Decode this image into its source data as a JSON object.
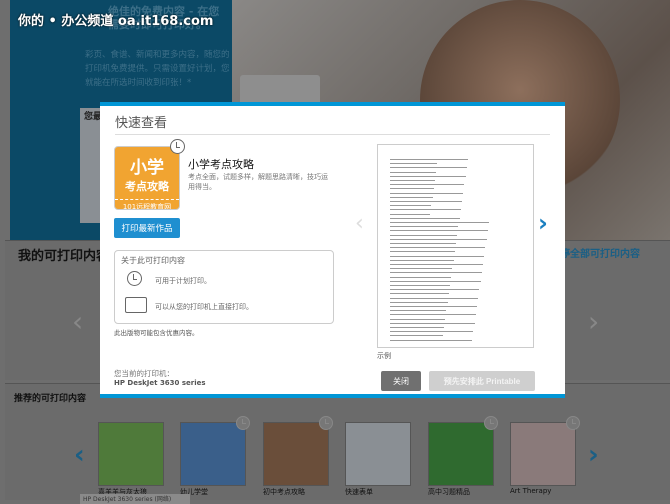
{
  "watermark": "你的 • 办公频道 oa.it168.com",
  "hero": {
    "heading": "绝佳的免费内容 - 在您需要时即可打印好。*",
    "text": "彩页、食谱、新闻和更多内容，随您的打印机免费提供。只需设置好计划，您就能在所选时间收到印张！*",
    "card_title": "您最好为"
  },
  "my_printables": {
    "title": "我的可打印内容",
    "pause_link": "暂停全部可打印内容"
  },
  "recommended": {
    "title": "推荐的可打印内容",
    "items": [
      {
        "label": "喜羊羊与灰太狼",
        "color": "#4f7a3a"
      },
      {
        "label": "幼儿学堂",
        "color": "#3a5f8a"
      },
      {
        "label": "初中考点攻略",
        "color": "#6a4e3a"
      },
      {
        "label": "快速表单",
        "color": "#8a8f94"
      },
      {
        "label": "高中习题精品",
        "color": "#2f6a2f"
      },
      {
        "label": "Art Therapy",
        "color": "#8a7a7a"
      }
    ],
    "tooltip": "HP DeskJet 3630 series (网络)"
  },
  "modal": {
    "title": "快速查看",
    "icon": {
      "line1": "小学",
      "line2": "考点攻略",
      "line3": "101远程教育网",
      "color": "#f1a431"
    },
    "item_title": "小学考点攻略",
    "item_desc": "考点全面，试题多样，解题思路清晰，技巧运用得当。",
    "print_latest": "打印最新作品",
    "about": {
      "title": "关于此可打印内容",
      "schedule": "可用于计划打印。",
      "direct": "可以从您的打印机上直接打印。"
    },
    "note": "此出版物可能包含优惠内容。",
    "printer_label": "您当前的打印机：",
    "printer_name": "HP DeskJet 3630 series",
    "sample_label": "示例",
    "close": "关闭",
    "schedule_btn": "预先安排此 Printable",
    "accent": "#0096d6"
  }
}
